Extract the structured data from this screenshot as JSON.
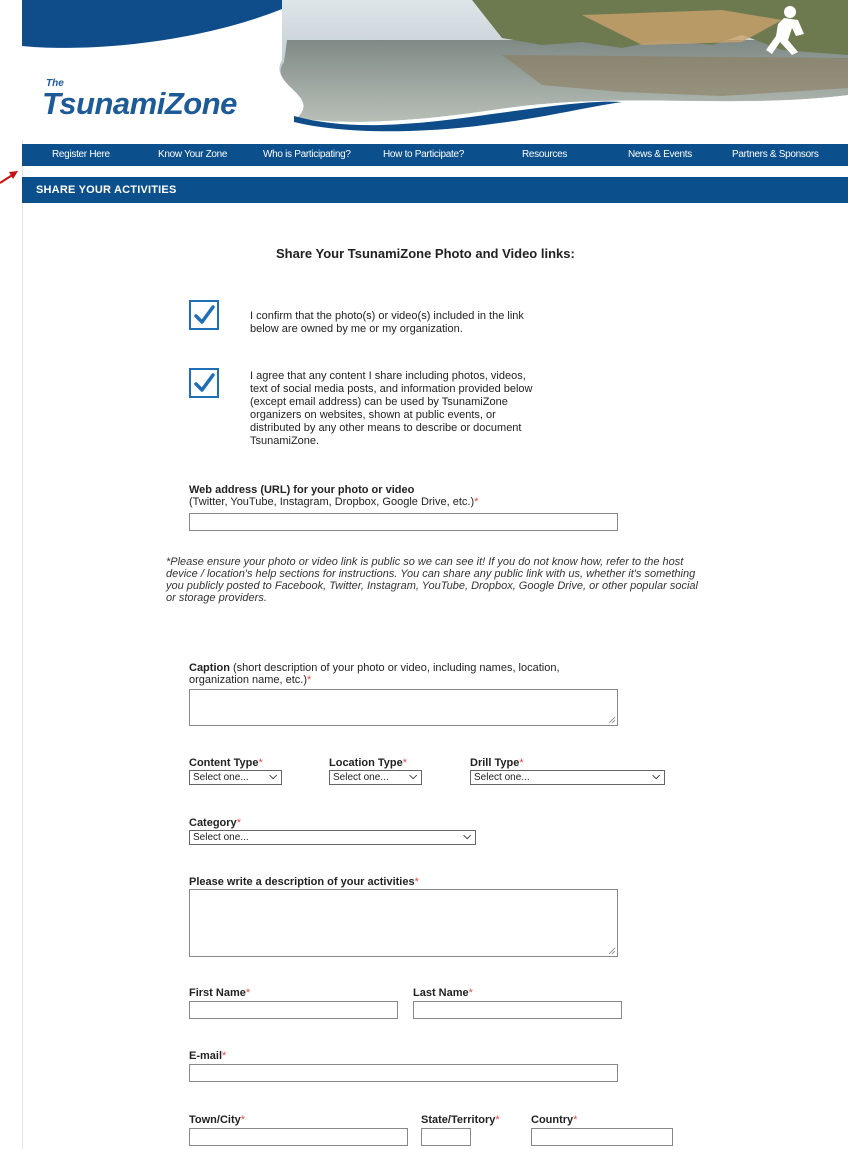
{
  "logo": {
    "prefix": "The",
    "name": "TsunamiZone"
  },
  "nav": [
    "Register Here",
    "Know Your Zone",
    "Who is Participating?",
    "How to Participate?",
    "Resources",
    "News & Events",
    "Partners & Sponsors"
  ],
  "section_title": "SHARE YOUR ACTIVITIES",
  "form": {
    "title": "Share Your TsunamiZone Photo and Video links:",
    "confirm1": [
      "I confirm that the photo(s) or video(s) included in the link",
      "below are owned by me or my organization."
    ],
    "confirm2": [
      "I agree that any content I share including photos, videos,",
      "text of social media posts, and information provided below",
      "(except email address) can be used by TsunamiZone",
      "organizers on websites, shown at public events, or",
      "distributed by any other means to describe or document",
      "TsunamiZone."
    ],
    "url_label": "Web address (URL) for your photo or video",
    "url_sub": "(Twitter, YouTube, Instagram, Dropbox, Google Drive, etc.)",
    "note": "*Please ensure your photo or video link is public so we can see it! If you do not know how, refer to the host device / location's help sections for instructions. You can share any public link with us, whether it's something you publicly posted to Facebook, Twitter, Instagram, YouTube, Dropbox, Google Drive, or other popular social or storage providers.",
    "caption_label": "Caption",
    "caption_sub_1": " (short description of your photo or video, including names, location,",
    "caption_sub_2": "organization name, etc.)",
    "content_type_label": "Content Type",
    "content_type_value": "Select one...",
    "location_type_label": "Location Type",
    "location_type_value": "Select one...",
    "drill_type_label": "Drill Type",
    "drill_type_value": "Select one...",
    "category_label": "Category",
    "category_value": "Select one...",
    "description_label": "Please write a description of your activities",
    "first_name_label": "First Name",
    "last_name_label": "Last Name",
    "email_label": "E-mail",
    "town_label": "Town/City",
    "state_label": "State/Territory",
    "country_label": "Country",
    "required_mark": "*"
  },
  "colors": {
    "brand_blue": "#0b4f8c",
    "logo_blue": "#1d5a98",
    "checkbox_blue": "#1e6fb8",
    "required": "#e04a4a"
  }
}
